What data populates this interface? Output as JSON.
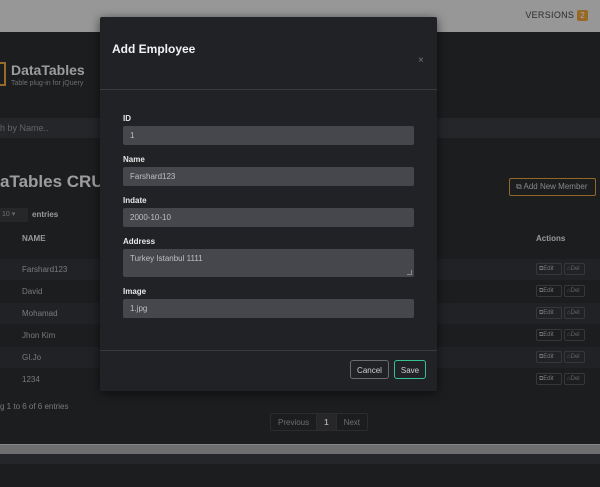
{
  "topbar": {
    "versions_label": "VERSIONS",
    "versions_count": "2"
  },
  "brand": {
    "title": "DataTables",
    "subtitle": "Table plug-in for jQuery"
  },
  "search": {
    "placeholder_visible": "h by Name.."
  },
  "section": {
    "title": "aTables CRUD",
    "add_button": "Add New Member"
  },
  "entries": {
    "selected": "10",
    "label": "entries"
  },
  "table": {
    "headers": {
      "name": "NAME",
      "actions": "Actions"
    },
    "rows": [
      {
        "name": "Farshard123"
      },
      {
        "name": "David"
      },
      {
        "name": "Mohamad"
      },
      {
        "name": "Jhon Kim"
      },
      {
        "name": "GI.Jo"
      },
      {
        "name": "1234"
      }
    ],
    "edit_label": "Edit",
    "del_label": "Del"
  },
  "footer": {
    "showing": "g 1 to 6 of 6 entries"
  },
  "pager": {
    "previous": "Previous",
    "current": "1",
    "next": "Next"
  },
  "modal": {
    "title": "Add Employee",
    "close": "×",
    "fields": {
      "id": {
        "label": "ID",
        "value": "1"
      },
      "name": {
        "label": "Name",
        "value": "Farshard123"
      },
      "indate": {
        "label": "Indate",
        "value": "2000-10-10"
      },
      "address": {
        "label": "Address",
        "value": "Turkey Istanbul 1111"
      },
      "image": {
        "label": "Image",
        "value": "1.jpg"
      }
    },
    "cancel_label": "Cancel",
    "save_label": "Save"
  },
  "colors": {
    "accent_orange": "#e8a23c",
    "save_green": "#36c28c",
    "modal_bg": "#202226",
    "input_bg": "#45474d"
  }
}
